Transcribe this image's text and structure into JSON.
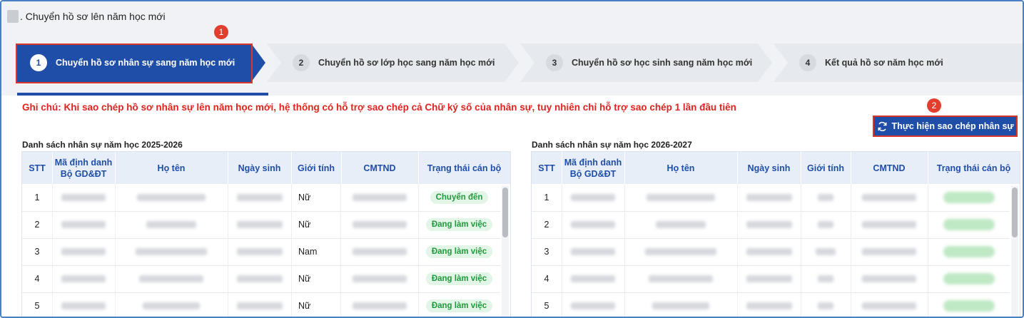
{
  "page": {
    "title": ". Chuyển hồ sơ lên năm học mới"
  },
  "steps": [
    {
      "num": "1",
      "label": "Chuyển hồ sơ nhân sự sang năm học mới",
      "active": true
    },
    {
      "num": "2",
      "label": "Chuyển hồ sơ lớp học sang năm học mới",
      "active": false
    },
    {
      "num": "3",
      "label": "Chuyển hồ sơ học sinh sang năm học mới",
      "active": false
    },
    {
      "num": "4",
      "label": "Kết quả hồ sơ năm học mới",
      "active": false
    }
  ],
  "callouts": {
    "one": "1",
    "two": "2"
  },
  "note": "Ghi chú: Khi sao chép hồ sơ nhân sự lên năm học mới, hệ thống có hỗ trợ sao chép cả Chữ ký số của nhân sự, tuy nhiên chỉ hỗ trợ sao chép 1 lần đầu tiên",
  "copy_button": {
    "label": "Thực hiện sao chép nhân sự",
    "icon": "sync-icon"
  },
  "columns": [
    "STT",
    "Mã định danh Bộ GD&ĐT",
    "Họ tên",
    "Ngày sinh",
    "Giới tính",
    "CMTND",
    "Trạng thái cán bộ"
  ],
  "left_table": {
    "title": "Danh sách nhân sự năm học 2025-2026",
    "rows": [
      {
        "stt": "1",
        "gender": "Nữ",
        "status": "Chuyển đến"
      },
      {
        "stt": "2",
        "gender": "Nữ",
        "status": "Đang làm việc"
      },
      {
        "stt": "3",
        "gender": "Nam",
        "status": "Đang làm việc"
      },
      {
        "stt": "4",
        "gender": "Nữ",
        "status": "Đang làm việc"
      },
      {
        "stt": "5",
        "gender": "Nữ",
        "status": "Đang làm việc"
      }
    ]
  },
  "right_table": {
    "title": "Danh sách nhân sự năm học 2026-2027",
    "rows": [
      {
        "stt": "1"
      },
      {
        "stt": "2"
      },
      {
        "stt": "3"
      },
      {
        "stt": "4"
      },
      {
        "stt": "5"
      }
    ]
  },
  "colors": {
    "primary": "#1f4ea8",
    "highlight": "#d9352c",
    "note": "#e0231e",
    "badge_text": "#1f9a3b",
    "badge_bg": "#e2f5e6"
  }
}
